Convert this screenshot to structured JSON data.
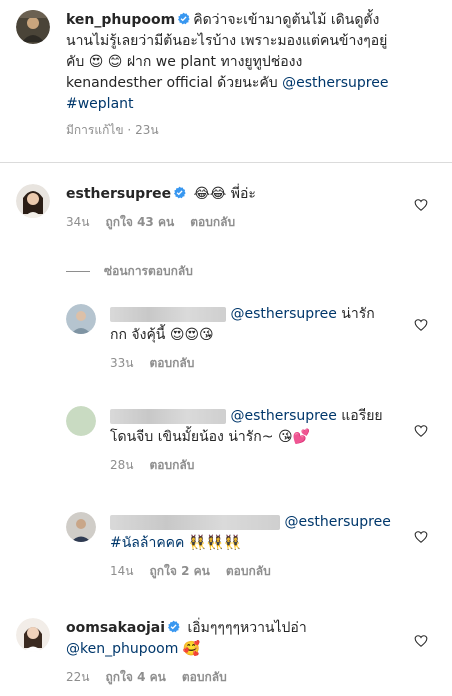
{
  "post": {
    "username": "ken_phupoom",
    "caption_line1": "คิดว่าจะเข้ามาดูต้นไม้ เดินดูตั้ง",
    "caption_line2": "นานไม่รู้เลยว่ามีต้นอะไรบ้าง เพราะมองแต่คนข้างๆอยู่",
    "caption_line3a": "คับ",
    "caption_emoji": "😍 😊",
    "caption_line3b": "ฝาก we plant ทางยูทูปช่องง",
    "caption_line4": "kenandesther official ด้วยนะคับ",
    "mention": "@esthersupree",
    "hashtag": "#weplant",
    "edited_label": "มีการแก้ไข",
    "time": "23น"
  },
  "comments": [
    {
      "username": "esthersupree",
      "emoji": "😂😂",
      "text": "พี่อ่ะ",
      "time": "34น",
      "likes": "ถูกใจ 43 คน",
      "reply_label": "ตอบกลับ"
    }
  ],
  "hide_replies_label": "ซ่อนการตอบกลับ",
  "replies": [
    {
      "mention": "@esthersupree",
      "text_a": "น่ารัก",
      "text_b": "กก จังคุ้นี้",
      "emoji": "😍😍😘",
      "time": "33น",
      "reply_label": "ตอบกลับ"
    },
    {
      "mention": "@esthersupree",
      "text_a": "แอรียย",
      "text_b": "โดนจีบ เขินมั้ยน้อง น่ารัก~",
      "emoji": "😘💕",
      "time": "28น",
      "reply_label": "ตอบกลับ"
    },
    {
      "mention": "@esthersupree",
      "hashtag": "#นัลล้าคคค",
      "emoji": "👯‍♀️👯‍♀️👯‍♀️",
      "time": "14น",
      "likes": "ถูกใจ 2 คน",
      "reply_label": "ตอบกลับ"
    }
  ],
  "last_comment": {
    "username": "oomsakaojai",
    "text": "เอิ่มๆๆๆๆหวานไปอ่า",
    "mention": "@ken_phupoom",
    "emoji": "🥰",
    "time": "22น",
    "likes": "ถูกใจ 4 คน",
    "reply_label": "ตอบกลับ"
  },
  "colors": {
    "text": "#262626",
    "secondary": "#8e8e8e",
    "link": "#00376b",
    "verified": "#3897f0",
    "divider": "#dbdbdb"
  },
  "icons": {
    "verified": "verified-badge-icon",
    "like": "heart-icon"
  }
}
